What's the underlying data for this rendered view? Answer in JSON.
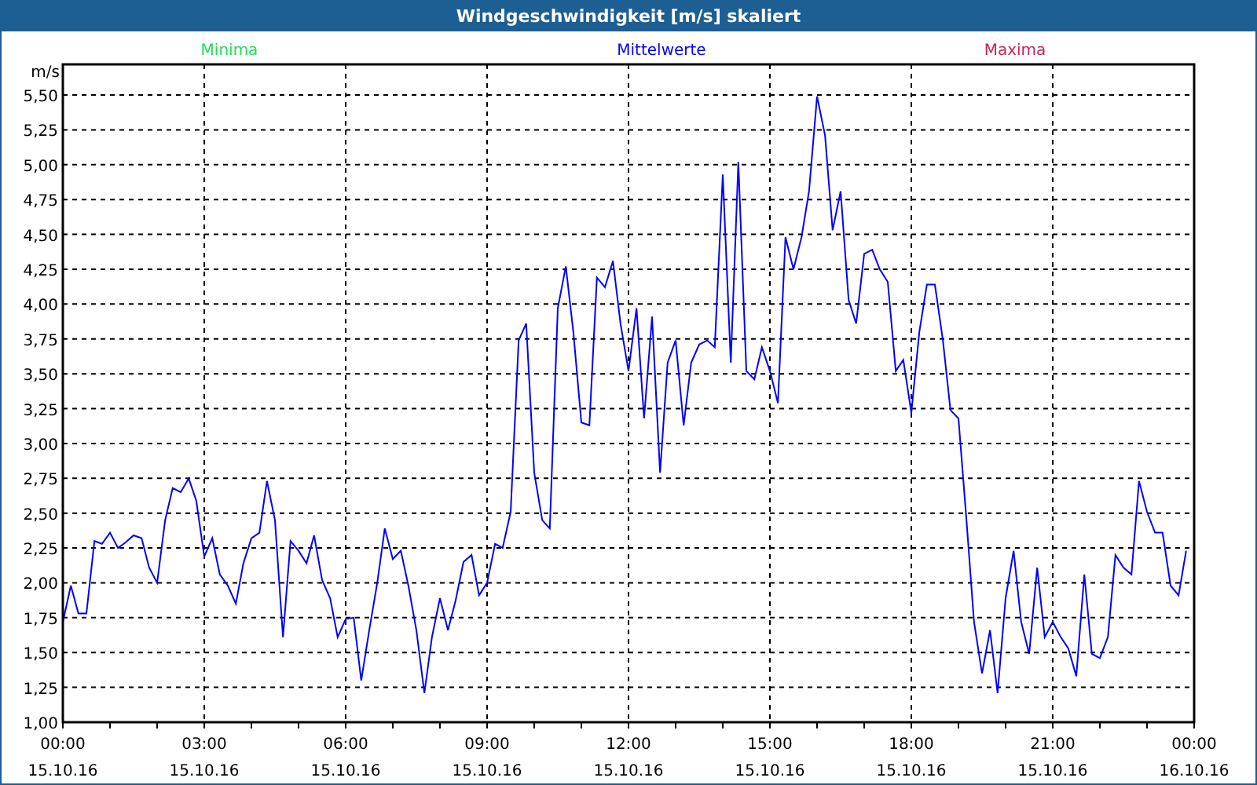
{
  "window": {
    "title": "Windgeschwindigkeit [m/s] skaliert"
  },
  "legend": [
    {
      "label": "Minima",
      "color": "#22dd55"
    },
    {
      "label": "Maxima",
      "color": "#cc2255"
    }
  ],
  "chart": {
    "unit": "m/s",
    "x_dates": [
      "15.10.16",
      "15.10.16",
      "15.10.16",
      "15.10.16",
      "15.10.16",
      "15.10.16",
      "15.10.16",
      "15.10.16",
      "16.10.16"
    ],
    "chart_data": {
      "type": "line",
      "grid": true,
      "xlim": [
        0,
        24
      ],
      "ylim": [
        1,
        5.72
      ],
      "x": [
        0,
        0.17,
        0.33,
        0.5,
        0.67,
        0.83,
        1,
        1.17,
        1.33,
        1.5,
        1.67,
        1.83,
        2,
        2.17,
        2.33,
        2.5,
        2.67,
        2.83,
        3,
        3.17,
        3.33,
        3.5,
        3.67,
        3.83,
        4,
        4.17,
        4.33,
        4.5,
        4.67,
        4.83,
        5,
        5.17,
        5.33,
        5.5,
        5.67,
        5.83,
        6,
        6.17,
        6.33,
        6.5,
        6.67,
        6.83,
        7,
        7.17,
        7.33,
        7.5,
        7.67,
        7.83,
        8,
        8.17,
        8.33,
        8.5,
        8.67,
        8.83,
        9,
        9.17,
        9.33,
        9.5,
        9.67,
        9.83,
        10,
        10.17,
        10.33,
        10.5,
        10.67,
        10.83,
        11,
        11.17,
        11.33,
        11.5,
        11.67,
        11.83,
        12,
        12.17,
        12.33,
        12.5,
        12.67,
        12.83,
        13,
        13.17,
        13.33,
        13.5,
        13.67,
        13.83,
        14,
        14.17,
        14.33,
        14.5,
        14.67,
        14.83,
        15,
        15.17,
        15.33,
        15.5,
        15.67,
        15.83,
        16,
        16.17,
        16.33,
        16.5,
        16.67,
        16.83,
        17,
        17.17,
        17.33,
        17.5,
        17.67,
        17.83,
        18,
        18.17,
        18.33,
        18.5,
        18.67,
        18.83,
        19,
        19.17,
        19.33,
        19.5,
        19.67,
        19.83,
        20,
        20.17,
        20.33,
        20.5,
        20.67,
        20.83,
        21,
        21.17,
        21.33,
        21.5,
        21.67,
        21.83,
        22,
        22.17,
        22.33,
        22.5,
        22.67,
        22.83,
        23,
        23.17,
        23.33,
        23.5,
        23.67,
        23.83
      ],
      "xticks": [
        {
          "value": 0,
          "label": "00:00"
        },
        {
          "value": 3,
          "label": "03:00"
        },
        {
          "value": 6,
          "label": "06:00"
        },
        {
          "value": 9,
          "label": "09:00"
        },
        {
          "value": 12,
          "label": "12:00"
        },
        {
          "value": 15,
          "label": "15:00"
        },
        {
          "value": 18,
          "label": "18:00"
        },
        {
          "value": 21,
          "label": "21:00"
        },
        {
          "value": 24,
          "label": "00:00"
        }
      ],
      "yticks": [
        {
          "value": 1,
          "label": "1,00"
        },
        {
          "value": 1.25,
          "label": "1,25"
        },
        {
          "value": 1.5,
          "label": "1,50"
        },
        {
          "value": 1.75,
          "label": "1,75"
        },
        {
          "value": 2,
          "label": "2,00"
        },
        {
          "value": 2.25,
          "label": "2,25"
        },
        {
          "value": 2.5,
          "label": "2,50"
        },
        {
          "value": 2.75,
          "label": "2,75"
        },
        {
          "value": 3,
          "label": "3,00"
        },
        {
          "value": 3.25,
          "label": "3,25"
        },
        {
          "value": 3.5,
          "label": "3,50"
        },
        {
          "value": 3.75,
          "label": "3,75"
        },
        {
          "value": 4,
          "label": "4,00"
        },
        {
          "value": 4.25,
          "label": "4,25"
        },
        {
          "value": 4.5,
          "label": "4,50"
        },
        {
          "value": 4.75,
          "label": "4,75"
        },
        {
          "value": 5,
          "label": "5,00"
        },
        {
          "value": 5.25,
          "label": "5,25"
        },
        {
          "value": 5.5,
          "label": "5,50"
        }
      ],
      "series": [
        {
          "name": "Mittelwerte",
          "color": "#0000ff",
          "values": [
            1.72,
            1.98,
            1.78,
            1.78,
            2.3,
            2.28,
            2.36,
            2.25,
            2.29,
            2.34,
            2.32,
            2.11,
            2.0,
            2.45,
            2.68,
            2.65,
            2.75,
            2.59,
            2.19,
            2.32,
            2.06,
            1.98,
            1.85,
            2.14,
            2.32,
            2.36,
            2.73,
            2.45,
            1.61,
            2.3,
            2.23,
            2.14,
            2.34,
            2.02,
            1.89,
            1.61,
            1.74,
            1.75,
            1.3,
            1.66,
            2.0,
            2.39,
            2.17,
            2.23,
            1.98,
            1.66,
            1.21,
            1.61,
            1.89,
            1.66,
            1.87,
            2.15,
            2.2,
            1.91,
            2.0,
            2.28,
            2.25,
            2.51,
            3.74,
            3.86,
            2.79,
            2.45,
            2.39,
            3.97,
            4.27,
            3.8,
            3.15,
            3.13,
            4.19,
            4.12,
            4.31,
            3.86,
            3.52,
            3.97,
            3.18,
            3.91,
            2.79,
            3.58,
            3.74,
            3.13,
            3.58,
            3.71,
            3.74,
            3.69,
            4.93,
            3.58,
            5.02,
            3.52,
            3.46,
            3.69,
            3.52,
            3.29,
            4.48,
            4.25,
            4.48,
            4.81,
            5.49,
            5.21,
            4.53,
            4.81,
            4.03,
            3.86,
            4.36,
            4.39,
            4.25,
            4.16,
            3.52,
            3.6,
            3.22,
            3.8,
            4.14,
            4.14,
            3.74,
            3.24,
            3.18,
            2.45,
            1.72,
            1.35,
            1.66,
            1.21,
            1.89,
            2.23,
            1.72,
            1.49,
            2.11,
            1.61,
            1.72,
            1.61,
            1.53,
            1.33,
            2.06,
            1.49,
            1.46,
            1.61,
            2.2,
            2.11,
            2.06,
            2.73,
            2.51,
            2.36,
            2.36,
            1.98,
            1.91,
            2.23
          ]
        }
      ]
    }
  }
}
